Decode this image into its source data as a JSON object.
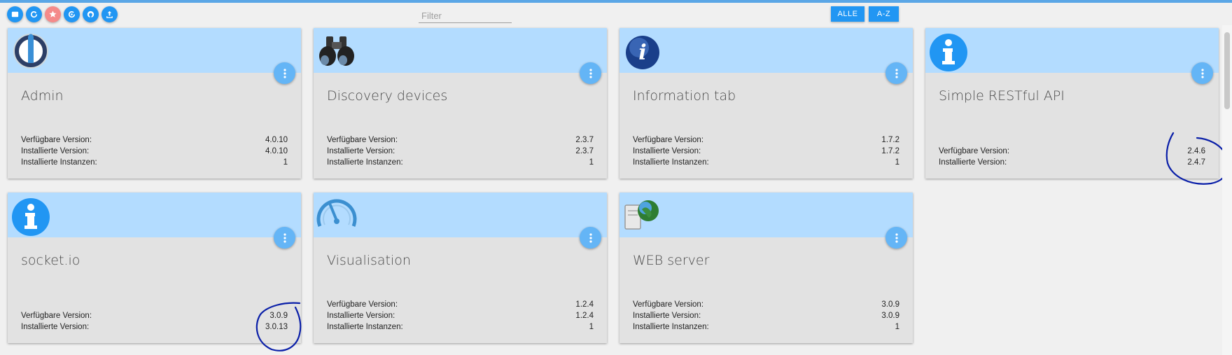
{
  "toolbar": {
    "icons": [
      "screen-icon",
      "refresh-icon",
      "star-icon",
      "update-icon",
      "github-icon",
      "upload-icon"
    ],
    "filter_placeholder": "Filter",
    "btn_alle": "ALLE",
    "btn_az": "A-Z"
  },
  "labels": {
    "available": "Verfügbare Version:",
    "installed": "Installierte Version:",
    "instances": "Installierte Instanzen:"
  },
  "cards": [
    {
      "title": "Admin",
      "available": "4.0.10",
      "installed": "4.0.10",
      "instances": "1"
    },
    {
      "title": "Discovery devices",
      "available": "2.3.7",
      "installed": "2.3.7",
      "instances": "1"
    },
    {
      "title": "Information tab",
      "available": "1.7.2",
      "installed": "1.7.2",
      "instances": "1"
    },
    {
      "title": "Simple RESTful API",
      "available": "2.4.6",
      "installed": "2.4.7"
    },
    {
      "title": "socket.io",
      "available": "3.0.9",
      "installed": "3.0.13"
    },
    {
      "title": "Visualisation",
      "available": "1.2.4",
      "installed": "1.2.4",
      "instances": "1"
    },
    {
      "title": "WEB server",
      "available": "3.0.9",
      "installed": "3.0.9",
      "instances": "1"
    }
  ],
  "colors": {
    "accent": "#2196f3",
    "card_header": "#b3dcff",
    "card_body": "#e2e2e2",
    "annotation": "#0a1fa8"
  }
}
